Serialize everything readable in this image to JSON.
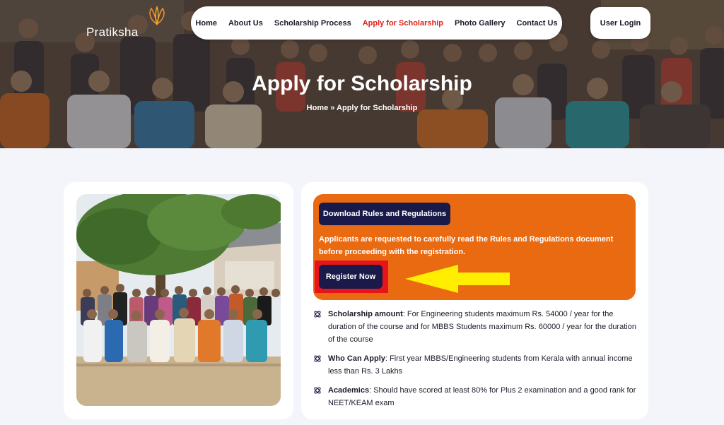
{
  "brand": {
    "name": "Pratiksha"
  },
  "nav": {
    "items": [
      "Home",
      "About Us",
      "Scholarship Process",
      "Apply for Scholarship",
      "Photo Gallery",
      "Contact Us"
    ],
    "active_index": 3,
    "login_label": "User Login"
  },
  "hero": {
    "title": "Apply for Scholarship",
    "breadcrumb": "Home » Apply for Scholarship"
  },
  "apply": {
    "download_label": "Download Rules and Regulations",
    "note": "Applicants are requested to carefully read the Rules and Regulations document before proceeding with the registration.",
    "register_label": "Register Now"
  },
  "details": [
    {
      "heading": "Scholarship amount",
      "text": ": For Engineering students maximum Rs. 54000 / year for the duration of the course and for MBBS Students maximum Rs. 60000 / year for the duration of the course"
    },
    {
      "heading": "Who Can Apply",
      "text": ": First year MBBS/Engineering students from Kerala with annual income less than Rs. 3 Lakhs"
    },
    {
      "heading": "Academics",
      "text": ": Should have scored at least 80% for Plus 2 examination and a good rank for NEET/KEAM exam"
    }
  ],
  "colors": {
    "accent": "#e0201b",
    "orange_panel": "#ea6a11",
    "button_navy": "#1a1a4a",
    "highlight": "#ffee00"
  }
}
